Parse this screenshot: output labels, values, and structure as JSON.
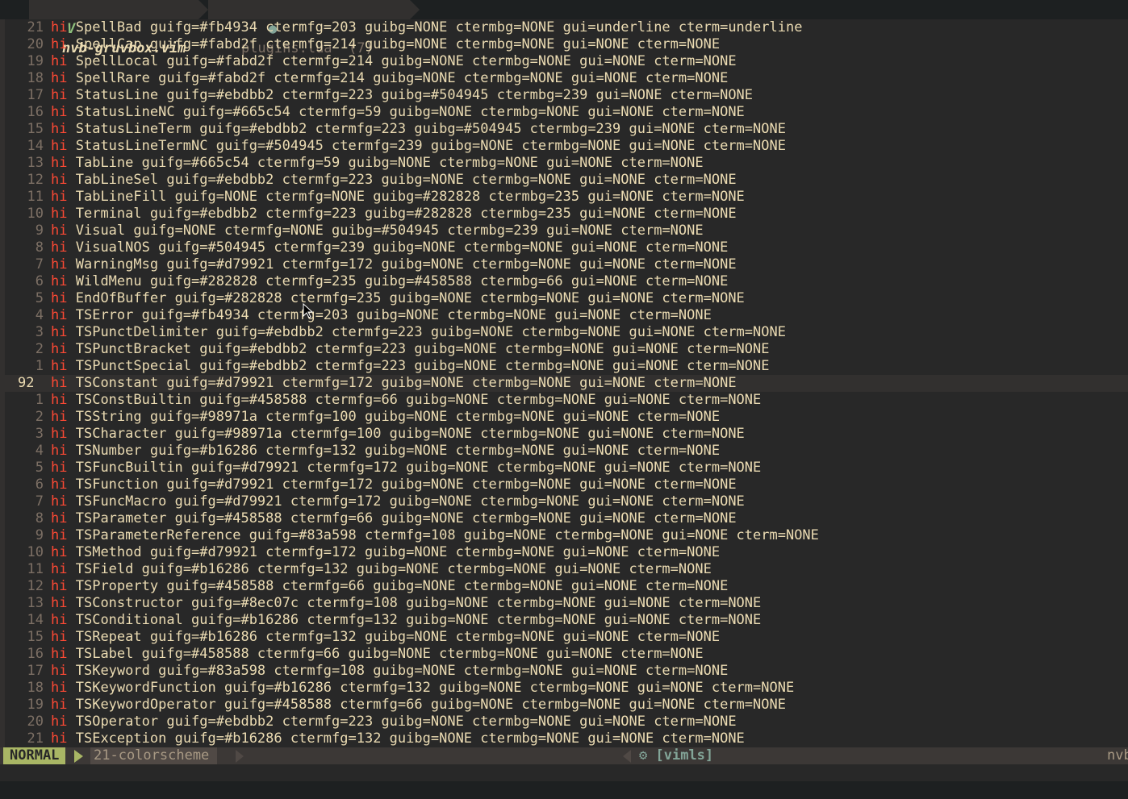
{
  "tabs": [
    {
      "icon": "V",
      "label": "nvb-gruvbox.vim",
      "active": true
    },
    {
      "icon": "●",
      "label": "plugins.lua  (7)",
      "active": false
    }
  ],
  "lines": [
    {
      "num": "21",
      "group": "SpellBad",
      "args": "guifg=#fb4934 ctermfg=203 guibg=NONE ctermbg=NONE gui=underline cterm=underline"
    },
    {
      "num": "20",
      "group": "SpellCap",
      "args": "guifg=#fabd2f ctermfg=214 guibg=NONE ctermbg=NONE gui=NONE cterm=NONE"
    },
    {
      "num": "19",
      "group": "SpellLocal",
      "args": "guifg=#fabd2f ctermfg=214 guibg=NONE ctermbg=NONE gui=NONE cterm=NONE"
    },
    {
      "num": "18",
      "group": "SpellRare",
      "args": "guifg=#fabd2f ctermfg=214 guibg=NONE ctermbg=NONE gui=NONE cterm=NONE"
    },
    {
      "num": "17",
      "group": "StatusLine",
      "args": "guifg=#ebdbb2 ctermfg=223 guibg=#504945 ctermbg=239 gui=NONE cterm=NONE"
    },
    {
      "num": "16",
      "group": "StatusLineNC",
      "args": "guifg=#665c54 ctermfg=59 guibg=NONE ctermbg=NONE gui=NONE cterm=NONE"
    },
    {
      "num": "15",
      "group": "StatusLineTerm",
      "args": "guifg=#ebdbb2 ctermfg=223 guibg=#504945 ctermbg=239 gui=NONE cterm=NONE"
    },
    {
      "num": "14",
      "group": "StatusLineTermNC",
      "args": "guifg=#504945 ctermfg=239 guibg=NONE ctermbg=NONE gui=NONE cterm=NONE"
    },
    {
      "num": "13",
      "group": "TabLine",
      "args": "guifg=#665c54 ctermfg=59 guibg=NONE ctermbg=NONE gui=NONE cterm=NONE"
    },
    {
      "num": "12",
      "group": "TabLineSel",
      "args": "guifg=#ebdbb2 ctermfg=223 guibg=NONE ctermbg=NONE gui=NONE cterm=NONE"
    },
    {
      "num": "11",
      "group": "TabLineFill",
      "args": "guifg=NONE ctermfg=NONE guibg=#282828 ctermbg=235 gui=NONE cterm=NONE"
    },
    {
      "num": "10",
      "group": "Terminal",
      "args": "guifg=#ebdbb2 ctermfg=223 guibg=#282828 ctermbg=235 gui=NONE cterm=NONE"
    },
    {
      "num": "9",
      "group": "Visual",
      "args": "guifg=NONE ctermfg=NONE guibg=#504945 ctermbg=239 gui=NONE cterm=NONE"
    },
    {
      "num": "8",
      "group": "VisualNOS",
      "args": "guifg=#504945 ctermfg=239 guibg=NONE ctermbg=NONE gui=NONE cterm=NONE"
    },
    {
      "num": "7",
      "group": "WarningMsg",
      "args": "guifg=#d79921 ctermfg=172 guibg=NONE ctermbg=NONE gui=NONE cterm=NONE"
    },
    {
      "num": "6",
      "group": "WildMenu",
      "args": "guifg=#282828 ctermfg=235 guibg=#458588 ctermbg=66 gui=NONE cterm=NONE"
    },
    {
      "num": "5",
      "group": "EndOfBuffer",
      "args": "guifg=#282828 ctermfg=235 guibg=NONE ctermbg=NONE gui=NONE cterm=NONE"
    },
    {
      "num": "4",
      "group": "TSError",
      "args": "guifg=#fb4934 ctermfg=203 guibg=NONE ctermbg=NONE gui=NONE cterm=NONE"
    },
    {
      "num": "3",
      "group": "TSPunctDelimiter",
      "args": "guifg=#ebdbb2 ctermfg=223 guibg=NONE ctermbg=NONE gui=NONE cterm=NONE"
    },
    {
      "num": "2",
      "group": "TSPunctBracket",
      "args": "guifg=#ebdbb2 ctermfg=223 guibg=NONE ctermbg=NONE gui=NONE cterm=NONE"
    },
    {
      "num": "1",
      "group": "TSPunctSpecial",
      "args": "guifg=#ebdbb2 ctermfg=223 guibg=NONE ctermbg=NONE gui=NONE cterm=NONE"
    },
    {
      "num": "92",
      "group": "TSConstant",
      "args": "guifg=#d79921 ctermfg=172 guibg=NONE ctermbg=NONE gui=NONE cterm=NONE",
      "cursor": true
    },
    {
      "num": "1",
      "group": "TSConstBuiltin",
      "args": "guifg=#458588 ctermfg=66 guibg=NONE ctermbg=NONE gui=NONE cterm=NONE"
    },
    {
      "num": "2",
      "group": "TSString",
      "args": "guifg=#98971a ctermfg=100 guibg=NONE ctermbg=NONE gui=NONE cterm=NONE"
    },
    {
      "num": "3",
      "group": "TSCharacter",
      "args": "guifg=#98971a ctermfg=100 guibg=NONE ctermbg=NONE gui=NONE cterm=NONE"
    },
    {
      "num": "4",
      "group": "TSNumber",
      "args": "guifg=#b16286 ctermfg=132 guibg=NONE ctermbg=NONE gui=NONE cterm=NONE"
    },
    {
      "num": "5",
      "group": "TSFuncBuiltin",
      "args": "guifg=#d79921 ctermfg=172 guibg=NONE ctermbg=NONE gui=NONE cterm=NONE"
    },
    {
      "num": "6",
      "group": "TSFunction",
      "args": "guifg=#d79921 ctermfg=172 guibg=NONE ctermbg=NONE gui=NONE cterm=NONE"
    },
    {
      "num": "7",
      "group": "TSFuncMacro",
      "args": "guifg=#d79921 ctermfg=172 guibg=NONE ctermbg=NONE gui=NONE cterm=NONE"
    },
    {
      "num": "8",
      "group": "TSParameter",
      "args": "guifg=#458588 ctermfg=66 guibg=NONE ctermbg=NONE gui=NONE cterm=NONE"
    },
    {
      "num": "9",
      "group": "TSParameterReference",
      "args": "guifg=#83a598 ctermfg=108 guibg=NONE ctermbg=NONE gui=NONE cterm=NONE"
    },
    {
      "num": "10",
      "group": "TSMethod",
      "args": "guifg=#d79921 ctermfg=172 guibg=NONE ctermbg=NONE gui=NONE cterm=NONE"
    },
    {
      "num": "11",
      "group": "TSField",
      "args": "guifg=#b16286 ctermfg=132 guibg=NONE ctermbg=NONE gui=NONE cterm=NONE"
    },
    {
      "num": "12",
      "group": "TSProperty",
      "args": "guifg=#458588 ctermfg=66 guibg=NONE ctermbg=NONE gui=NONE cterm=NONE"
    },
    {
      "num": "13",
      "group": "TSConstructor",
      "args": "guifg=#8ec07c ctermfg=108 guibg=NONE ctermbg=NONE gui=NONE cterm=NONE"
    },
    {
      "num": "14",
      "group": "TSConditional",
      "args": "guifg=#b16286 ctermfg=132 guibg=NONE ctermbg=NONE gui=NONE cterm=NONE"
    },
    {
      "num": "15",
      "group": "TSRepeat",
      "args": "guifg=#b16286 ctermfg=132 guibg=NONE ctermbg=NONE gui=NONE cterm=NONE"
    },
    {
      "num": "16",
      "group": "TSLabel",
      "args": "guifg=#458588 ctermfg=66 guibg=NONE ctermbg=NONE gui=NONE cterm=NONE"
    },
    {
      "num": "17",
      "group": "TSKeyword",
      "args": "guifg=#83a598 ctermfg=108 guibg=NONE ctermbg=NONE gui=NONE cterm=NONE"
    },
    {
      "num": "18",
      "group": "TSKeywordFunction",
      "args": "guifg=#b16286 ctermfg=132 guibg=NONE ctermbg=NONE gui=NONE cterm=NONE"
    },
    {
      "num": "19",
      "group": "TSKeywordOperator",
      "args": "guifg=#458588 ctermfg=66 guibg=NONE ctermbg=NONE gui=NONE cterm=NONE"
    },
    {
      "num": "20",
      "group": "TSOperator",
      "args": "guifg=#ebdbb2 ctermfg=223 guibg=NONE ctermbg=NONE gui=NONE cterm=NONE"
    },
    {
      "num": "21",
      "group": "TSException",
      "args": "guifg=#b16286 ctermfg=132 guibg=NONE ctermbg=NONE gui=NONE cterm=NONE"
    }
  ],
  "keyword": "hi",
  "statusline": {
    "mode": "NORMAL",
    "branch_icon": "",
    "branch": "21-colorscheme",
    "filetype_icon": "⚙",
    "filetype": "[vimls]",
    "trailing": "nvb"
  },
  "colors": {
    "background": "#282828",
    "keyword": "#fb4934",
    "mode_bg": "#a9b665",
    "accent": "#83a598"
  }
}
